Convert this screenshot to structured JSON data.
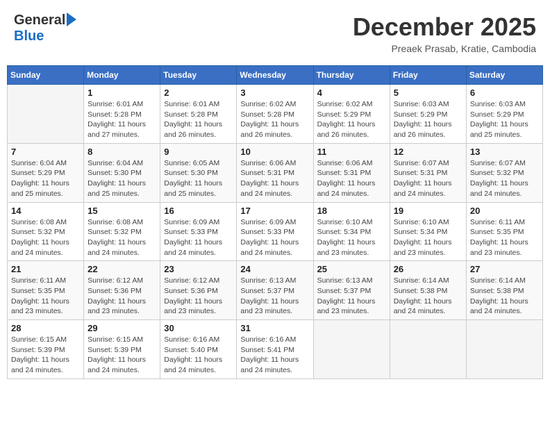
{
  "header": {
    "logo": {
      "general": "General",
      "blue": "Blue"
    },
    "title": "December 2025",
    "location": "Preaek Prasab, Kratie, Cambodia"
  },
  "calendar": {
    "days_of_week": [
      "Sunday",
      "Monday",
      "Tuesday",
      "Wednesday",
      "Thursday",
      "Friday",
      "Saturday"
    ],
    "weeks": [
      [
        {
          "day": "",
          "info": ""
        },
        {
          "day": "1",
          "info": "Sunrise: 6:01 AM\nSunset: 5:28 PM\nDaylight: 11 hours\nand 27 minutes."
        },
        {
          "day": "2",
          "info": "Sunrise: 6:01 AM\nSunset: 5:28 PM\nDaylight: 11 hours\nand 26 minutes."
        },
        {
          "day": "3",
          "info": "Sunrise: 6:02 AM\nSunset: 5:28 PM\nDaylight: 11 hours\nand 26 minutes."
        },
        {
          "day": "4",
          "info": "Sunrise: 6:02 AM\nSunset: 5:29 PM\nDaylight: 11 hours\nand 26 minutes."
        },
        {
          "day": "5",
          "info": "Sunrise: 6:03 AM\nSunset: 5:29 PM\nDaylight: 11 hours\nand 26 minutes."
        },
        {
          "day": "6",
          "info": "Sunrise: 6:03 AM\nSunset: 5:29 PM\nDaylight: 11 hours\nand 25 minutes."
        }
      ],
      [
        {
          "day": "7",
          "info": "Sunrise: 6:04 AM\nSunset: 5:29 PM\nDaylight: 11 hours\nand 25 minutes."
        },
        {
          "day": "8",
          "info": "Sunrise: 6:04 AM\nSunset: 5:30 PM\nDaylight: 11 hours\nand 25 minutes."
        },
        {
          "day": "9",
          "info": "Sunrise: 6:05 AM\nSunset: 5:30 PM\nDaylight: 11 hours\nand 25 minutes."
        },
        {
          "day": "10",
          "info": "Sunrise: 6:06 AM\nSunset: 5:31 PM\nDaylight: 11 hours\nand 24 minutes."
        },
        {
          "day": "11",
          "info": "Sunrise: 6:06 AM\nSunset: 5:31 PM\nDaylight: 11 hours\nand 24 minutes."
        },
        {
          "day": "12",
          "info": "Sunrise: 6:07 AM\nSunset: 5:31 PM\nDaylight: 11 hours\nand 24 minutes."
        },
        {
          "day": "13",
          "info": "Sunrise: 6:07 AM\nSunset: 5:32 PM\nDaylight: 11 hours\nand 24 minutes."
        }
      ],
      [
        {
          "day": "14",
          "info": "Sunrise: 6:08 AM\nSunset: 5:32 PM\nDaylight: 11 hours\nand 24 minutes."
        },
        {
          "day": "15",
          "info": "Sunrise: 6:08 AM\nSunset: 5:32 PM\nDaylight: 11 hours\nand 24 minutes."
        },
        {
          "day": "16",
          "info": "Sunrise: 6:09 AM\nSunset: 5:33 PM\nDaylight: 11 hours\nand 24 minutes."
        },
        {
          "day": "17",
          "info": "Sunrise: 6:09 AM\nSunset: 5:33 PM\nDaylight: 11 hours\nand 24 minutes."
        },
        {
          "day": "18",
          "info": "Sunrise: 6:10 AM\nSunset: 5:34 PM\nDaylight: 11 hours\nand 23 minutes."
        },
        {
          "day": "19",
          "info": "Sunrise: 6:10 AM\nSunset: 5:34 PM\nDaylight: 11 hours\nand 23 minutes."
        },
        {
          "day": "20",
          "info": "Sunrise: 6:11 AM\nSunset: 5:35 PM\nDaylight: 11 hours\nand 23 minutes."
        }
      ],
      [
        {
          "day": "21",
          "info": "Sunrise: 6:11 AM\nSunset: 5:35 PM\nDaylight: 11 hours\nand 23 minutes."
        },
        {
          "day": "22",
          "info": "Sunrise: 6:12 AM\nSunset: 5:36 PM\nDaylight: 11 hours\nand 23 minutes."
        },
        {
          "day": "23",
          "info": "Sunrise: 6:12 AM\nSunset: 5:36 PM\nDaylight: 11 hours\nand 23 minutes."
        },
        {
          "day": "24",
          "info": "Sunrise: 6:13 AM\nSunset: 5:37 PM\nDaylight: 11 hours\nand 23 minutes."
        },
        {
          "day": "25",
          "info": "Sunrise: 6:13 AM\nSunset: 5:37 PM\nDaylight: 11 hours\nand 23 minutes."
        },
        {
          "day": "26",
          "info": "Sunrise: 6:14 AM\nSunset: 5:38 PM\nDaylight: 11 hours\nand 24 minutes."
        },
        {
          "day": "27",
          "info": "Sunrise: 6:14 AM\nSunset: 5:38 PM\nDaylight: 11 hours\nand 24 minutes."
        }
      ],
      [
        {
          "day": "28",
          "info": "Sunrise: 6:15 AM\nSunset: 5:39 PM\nDaylight: 11 hours\nand 24 minutes."
        },
        {
          "day": "29",
          "info": "Sunrise: 6:15 AM\nSunset: 5:39 PM\nDaylight: 11 hours\nand 24 minutes."
        },
        {
          "day": "30",
          "info": "Sunrise: 6:16 AM\nSunset: 5:40 PM\nDaylight: 11 hours\nand 24 minutes."
        },
        {
          "day": "31",
          "info": "Sunrise: 6:16 AM\nSunset: 5:41 PM\nDaylight: 11 hours\nand 24 minutes."
        },
        {
          "day": "",
          "info": ""
        },
        {
          "day": "",
          "info": ""
        },
        {
          "day": "",
          "info": ""
        }
      ]
    ]
  }
}
